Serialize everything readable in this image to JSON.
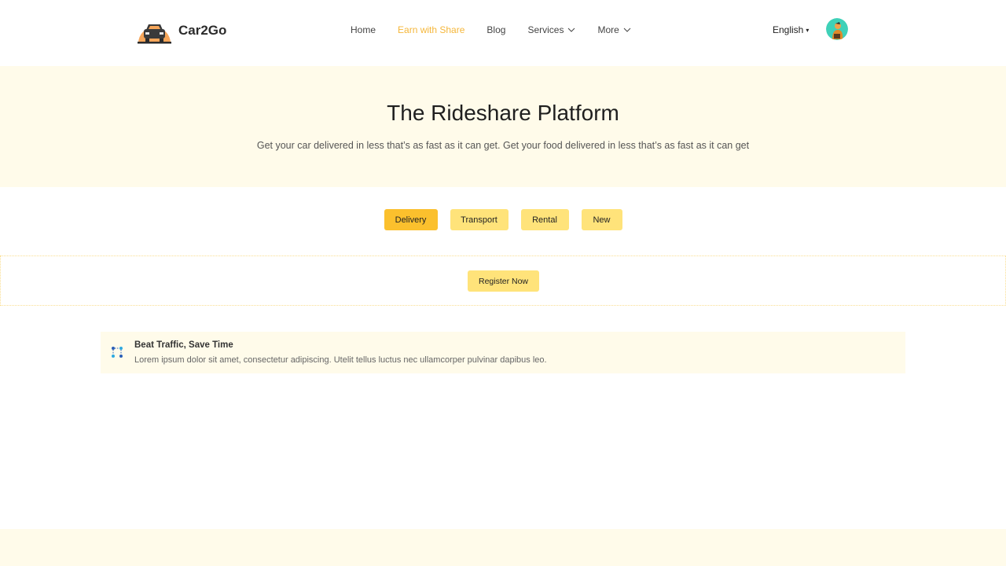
{
  "header": {
    "brand": "Car2Go",
    "nav": [
      {
        "label": "Home"
      },
      {
        "label": "Earn with Share"
      },
      {
        "label": "Blog"
      },
      {
        "label": "Services"
      },
      {
        "label": "More"
      }
    ],
    "language": "English"
  },
  "hero": {
    "title": "The Rideshare Platform",
    "subtitle": "Get your car delivered in less that’s as fast as it can get. Get your food delivered in less that’s as fast as it can get"
  },
  "tabs": [
    {
      "label": "Delivery",
      "active": true
    },
    {
      "label": "Transport"
    },
    {
      "label": "Rental"
    },
    {
      "label": "New"
    }
  ],
  "register": {
    "label": "Register Now"
  },
  "feature": {
    "title": "Beat Traffic, Save Time",
    "text": "Lorem ipsum dolor sit amet, consectetur adipiscing. Utelit tellus luctus nec ullamcorper pulvinar dapibus leo.",
    "icon": "route-icon"
  },
  "colors": {
    "accent": "#fbc02d",
    "accent_light": "#ffe37a",
    "cream": "#fffbea",
    "nav_active": "#f5b73b"
  }
}
